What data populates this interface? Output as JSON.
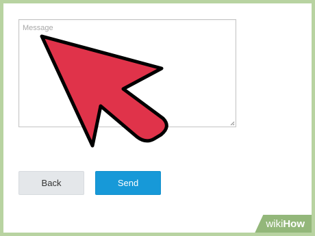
{
  "message": {
    "placeholder": "Message",
    "value": ""
  },
  "buttons": {
    "back_label": "Back",
    "send_label": "Send"
  },
  "watermark": {
    "prefix": "wiki",
    "suffix": "How"
  },
  "colors": {
    "frame_border": "#b8d3a1",
    "send_button": "#1799d8",
    "back_button": "#e4e7ea",
    "pointer_fill": "#e0334a"
  },
  "icons": {
    "pointer": "arrow-pointer-icon",
    "resize": "resize-grip-icon"
  }
}
